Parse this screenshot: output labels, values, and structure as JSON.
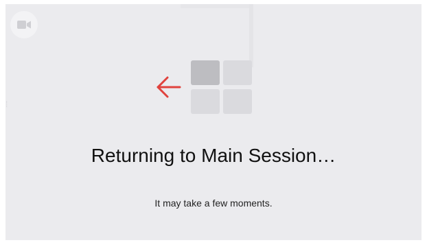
{
  "message": {
    "title": "Returning to Main Session…",
    "subtitle": "It may take a few moments."
  },
  "icons": {
    "video": "video-camera-icon",
    "arrow": "arrow-left-icon",
    "layout": "breakout-grid-icon"
  },
  "colors": {
    "background": "#ebebee",
    "arrow": "#e0423d",
    "grid_active": "#bdbdc1",
    "grid_inactive": "#dadade",
    "text": "#111111"
  }
}
